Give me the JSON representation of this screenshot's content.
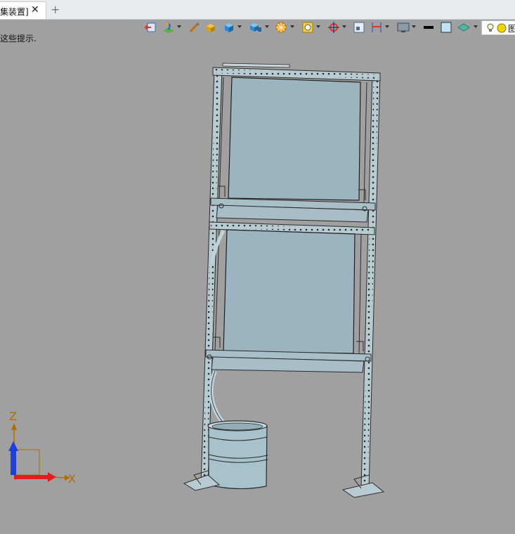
{
  "tabs": [
    {
      "label": "集装置]",
      "active": true
    }
  ],
  "tab_add_label": "+",
  "tab_close_label": "✕",
  "hint_text": "这些提示.",
  "toolbar_icons": [
    "exit-sketch-icon",
    "sketch-plane-icon",
    "brush-icon",
    "solid-box-icon",
    "cube-icon",
    "multi-cube-icon",
    "render-wheel-icon",
    "view-zoom-icon",
    "target-icon",
    "frame-icon",
    "section-icon",
    "display-icon",
    "line-style-icon",
    "color-swatch-icon",
    "layer-icon",
    "lightbulb-icon",
    "status-icon"
  ],
  "status_text": "图",
  "axes": {
    "z_label": "Z",
    "x_label": "X",
    "z_color": "#1f3fd8",
    "x_color": "#e01e1e",
    "origin_color": "#b06d00"
  },
  "model": {
    "name": "frame-assembly",
    "panel_color": "#9bb4c0",
    "barrel_color": "#a8c2cc",
    "frame_color": "#2a2a2a"
  }
}
